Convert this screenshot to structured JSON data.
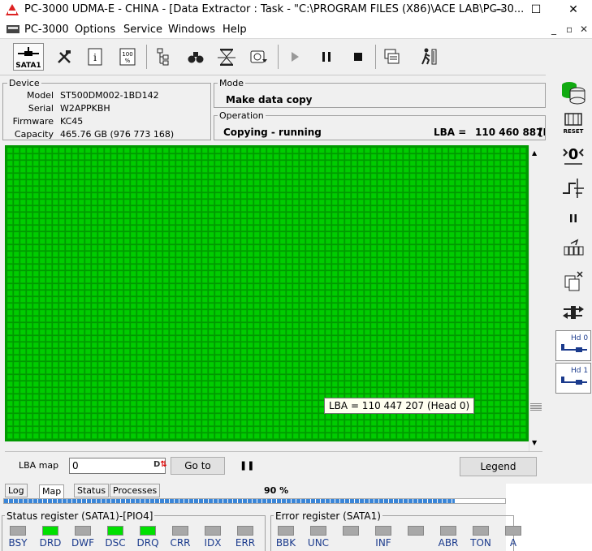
{
  "window": {
    "title": "PC-3000 UDMA-E - CHINA - [Data Extractor : Task - \"C:\\PROGRAM FILES (X86)\\ACE LAB\\PC-30...",
    "minimize": "—",
    "maximize": "☐",
    "close": "✕"
  },
  "menu": {
    "app_label": "PC-3000",
    "items": [
      "Options",
      "Service",
      "Windows",
      "Help"
    ],
    "mdi_min": "_",
    "mdi_restore": "▫",
    "mdi_close": "✕"
  },
  "toolbar": {
    "port_label": "SATA1"
  },
  "device": {
    "title": "Device",
    "model_label": "Model",
    "model": "ST500DM002-1BD142",
    "serial_label": "Serial",
    "serial": "W2APPKBH",
    "firmware_label": "Firmware",
    "firmware": "KC45",
    "capacity_label": "Capacity",
    "capacity": "465.76 GB (976 773 168)"
  },
  "mode": {
    "title": "Mode",
    "value": "Make data copy"
  },
  "operation": {
    "title": "Operation",
    "status": "Copying - running",
    "lba_label": "LBA =",
    "lba_value": "110 460 887",
    "lba_suffix": "[H"
  },
  "map_tooltip": "LBA =  110 447 207 (Head 0)",
  "lba_map": {
    "label": "LBA map",
    "input_value": "0",
    "goto_label": "Go to",
    "pause_glyph": "❚❚",
    "legend_label": "Legend"
  },
  "tabs": [
    "Log",
    "Map",
    "Status",
    "Processes"
  ],
  "progress": {
    "label": "90 %",
    "value": 0.9
  },
  "status_register": {
    "title": "Status register (SATA1)-[PIO4]",
    "bits": [
      {
        "name": "BSY",
        "on": false
      },
      {
        "name": "DRD",
        "on": true
      },
      {
        "name": "DWF",
        "on": false
      },
      {
        "name": "DSC",
        "on": true
      },
      {
        "name": "DRQ",
        "on": true
      },
      {
        "name": "CRR",
        "on": false
      },
      {
        "name": "IDX",
        "on": false
      },
      {
        "name": "ERR",
        "on": false
      }
    ]
  },
  "error_register": {
    "title": "Error register (SATA1)",
    "bits": [
      {
        "name": "BBK",
        "on": false
      },
      {
        "name": "UNC",
        "on": false
      },
      {
        "name": "",
        "on": false
      },
      {
        "name": "INF",
        "on": false
      },
      {
        "name": "",
        "on": false
      },
      {
        "name": "ABR",
        "on": false
      },
      {
        "name": "TON",
        "on": false
      },
      {
        "name": "A",
        "on": false
      }
    ]
  },
  "right_panel": {
    "reset_label": "RESET",
    "hd0_label": "Hd 0",
    "hd1_label": "Hd 1"
  },
  "colors": {
    "map_green": "#00cc00",
    "map_border": "#009900",
    "led_on": "#00e000",
    "led_off": "#a8a8a8",
    "progress": "#3a86d8"
  }
}
